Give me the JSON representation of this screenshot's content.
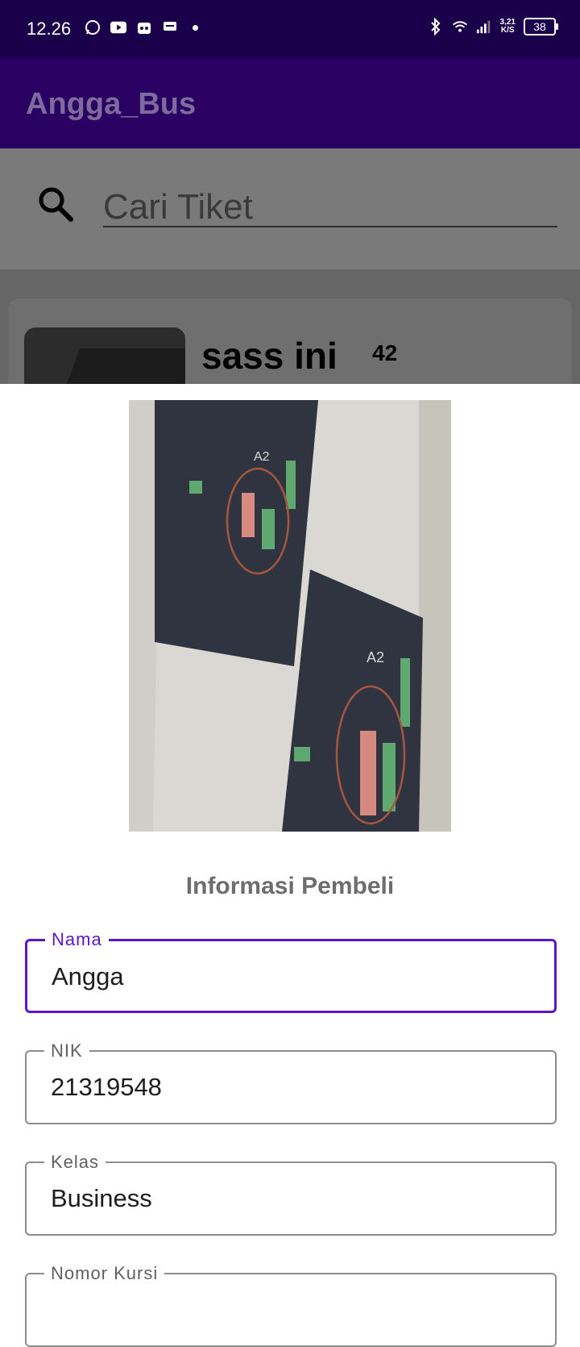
{
  "status_bar": {
    "time": "12.26",
    "net_speed_value": "3,21",
    "net_speed_unit": "K/S",
    "battery": "38",
    "left_icons": [
      "whatsapp-icon",
      "youtube-icon",
      "app-icon",
      "message-icon",
      "dot-icon"
    ],
    "right_icons": [
      "bluetooth-icon",
      "wifi-icon",
      "signal-icon"
    ]
  },
  "app_bar": {
    "title": "Angga_Bus"
  },
  "search": {
    "placeholder": "Cari Tiket"
  },
  "ticket": {
    "name": "sass ini",
    "price": "42"
  },
  "form": {
    "title": "Informasi Pembeli",
    "fields": [
      {
        "label": "Nama",
        "value": "Angga",
        "focused": true
      },
      {
        "label": "NIK",
        "value": "21319548"
      },
      {
        "label": "Kelas",
        "value": "Business"
      },
      {
        "label": "Nomor Kursi",
        "value": ""
      }
    ]
  },
  "colors": {
    "status_bar": "#1a004a",
    "app_bar": "#2a0062",
    "accent": "#5b16c9"
  }
}
